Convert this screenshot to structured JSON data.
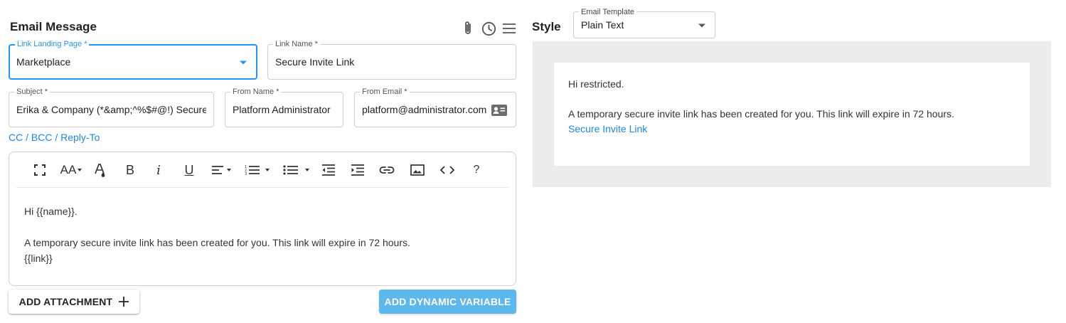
{
  "email_message": {
    "title": "Email Message",
    "icons": [
      "paperclip-icon",
      "clock-icon",
      "menu-icon"
    ]
  },
  "fields": {
    "link_landing_page": {
      "label": "Link Landing Page *",
      "value": "Marketplace"
    },
    "link_name": {
      "label": "Link Name *",
      "value": "Secure Invite Link"
    },
    "subject": {
      "label": "Subject *",
      "value": "Erika & Company (*&amp;^%$#@!) Secure I"
    },
    "from_name": {
      "label": "From Name *",
      "value": "Platform Administrator"
    },
    "from_email": {
      "label": "From Email *",
      "value": "platform@administrator.com"
    }
  },
  "cc_bcc_link": "CC / BCC / Reply-To",
  "editor": {
    "toolbar": {
      "font_size": "AA",
      "bold": "B",
      "italic": "i",
      "underline": "U",
      "help": "?"
    },
    "body": {
      "line1": "Hi {{name}}.",
      "line2": "A temporary secure invite link has been created for you. This link will expire in 72 hours.",
      "line3": "{{link}}"
    }
  },
  "buttons": {
    "add_attachment": "ADD ATTACHMENT",
    "add_dynamic_variable": "ADD DYNAMIC VARIABLE"
  },
  "style": {
    "title": "Style",
    "email_template": {
      "label": "Email Template",
      "value": "Plain Text"
    }
  },
  "preview": {
    "greeting": "Hi restricted.",
    "message": "A temporary secure invite link has been created for you. This link will expire in 72 hours.",
    "link_text": "Secure Invite Link"
  },
  "colors": {
    "accent": "#2196f3",
    "link": "#1e88e5",
    "primary_button": "#5cb8ec",
    "preview_background": "#ececed"
  }
}
